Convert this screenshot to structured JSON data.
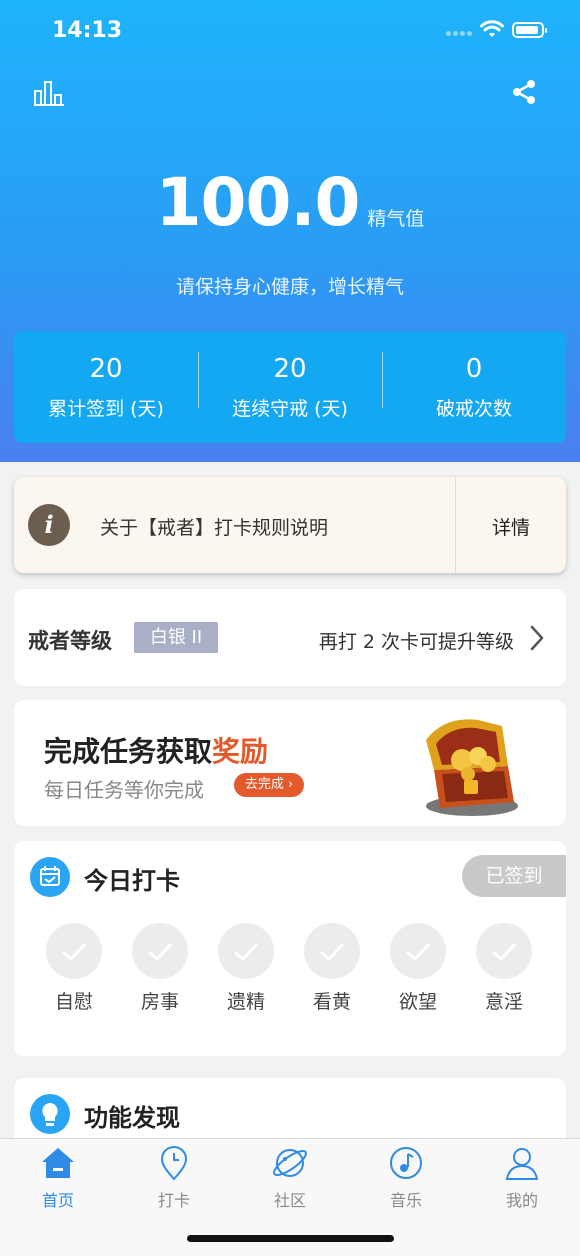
{
  "status_bar": {
    "time": "14:13"
  },
  "header": {
    "value": "100.0",
    "unit": "精气值",
    "subtitle": "请保持身心健康，增长精气"
  },
  "stats": [
    {
      "value": "20",
      "label": "累计签到 (天)"
    },
    {
      "value": "20",
      "label": "连续守戒 (天)"
    },
    {
      "value": "0",
      "label": "破戒次数"
    }
  ],
  "notice": {
    "icon": "info-icon",
    "text": "关于【戒者】打卡规则说明",
    "detail_label": "详情"
  },
  "level": {
    "title": "戒者等级",
    "badge": "白银 II",
    "hint": "再打 2 次卡可提升等级"
  },
  "task": {
    "title_prefix": "完成任务获取",
    "title_accent": "奖励",
    "subtitle": "每日任务等你完成",
    "button_label": "去完成"
  },
  "checkin": {
    "title": "今日打卡",
    "status_label": "已签到",
    "items": [
      "自慰",
      "房事",
      "遗精",
      "看黄",
      "欲望",
      "意淫"
    ]
  },
  "discover": {
    "title": "功能发现"
  },
  "tabs": [
    {
      "label": "首页",
      "icon": "home-icon",
      "active": true
    },
    {
      "label": "打卡",
      "icon": "location-pin-icon",
      "active": false
    },
    {
      "label": "社区",
      "icon": "planet-icon",
      "active": false
    },
    {
      "label": "音乐",
      "icon": "music-icon",
      "active": false
    },
    {
      "label": "我的",
      "icon": "user-icon",
      "active": false
    }
  ],
  "colors": {
    "hero_top": "#1eb3fb",
    "hero_bottom": "#4a7ff0",
    "accent_orange": "#e25a2b",
    "tab_active": "#2f8be6"
  }
}
